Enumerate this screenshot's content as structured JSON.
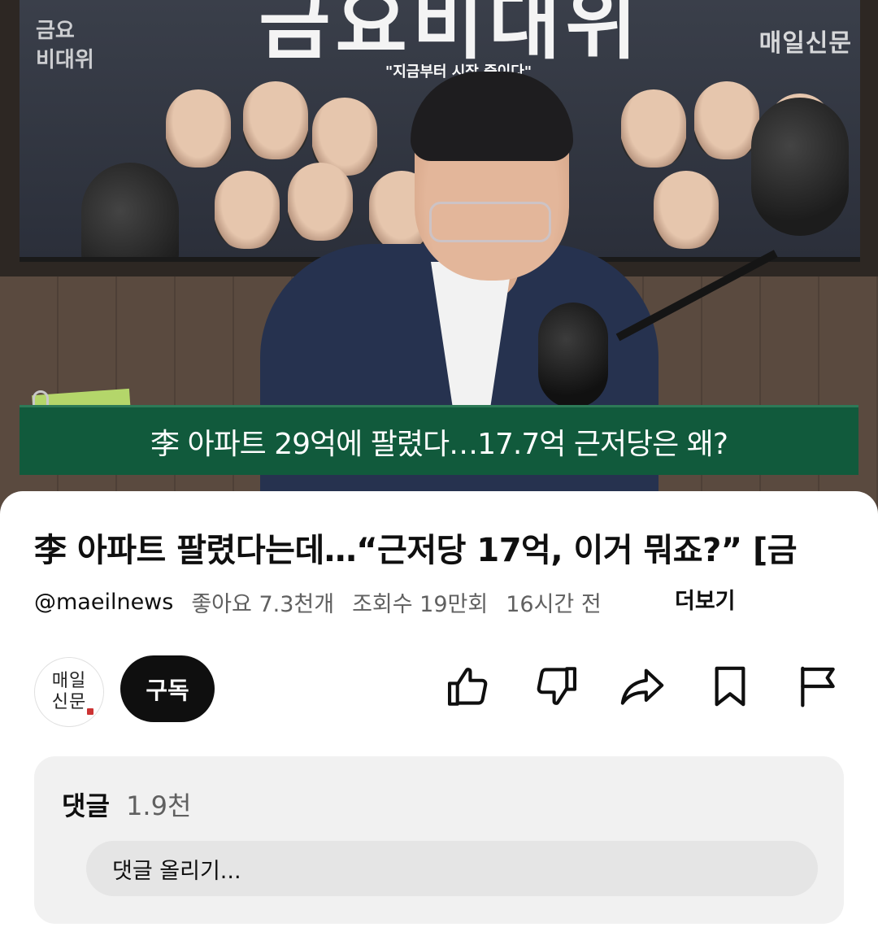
{
  "video": {
    "screen_title": "금요비대위",
    "screen_subtitle": "\"지금부터 시작 중이다\"",
    "screen_tag": "금요\n비대위",
    "watermark": "매일신문",
    "caption": "李 아파트 29억에 팔렸다…17.7억 근저당은 왜?"
  },
  "video_info": {
    "title": "李 아파트 팔렸다는데…“근저당 17억, 이거 뭐죠?” [금",
    "handle": "@maeilnews",
    "likes": "좋아요 7.3천개",
    "views": "조회수 19만회",
    "time_ago": "16시간 전",
    "more_label": "더보기"
  },
  "channel": {
    "avatar_text": "매일\n신문",
    "subscribe_label": "구독"
  },
  "actions": [
    {
      "icon": "thumbs-up-icon"
    },
    {
      "icon": "thumbs-down-icon"
    },
    {
      "icon": "share-icon"
    },
    {
      "icon": "save-icon"
    },
    {
      "icon": "report-flag-icon"
    }
  ],
  "comments": {
    "label": "댓글",
    "count": "1.9천",
    "input_placeholder": "댓글 올리기..."
  },
  "colors": {
    "caption_bar": "#115a3c",
    "subscribe_bg": "#0f0f0f",
    "comments_bg": "#f1f1f1"
  }
}
